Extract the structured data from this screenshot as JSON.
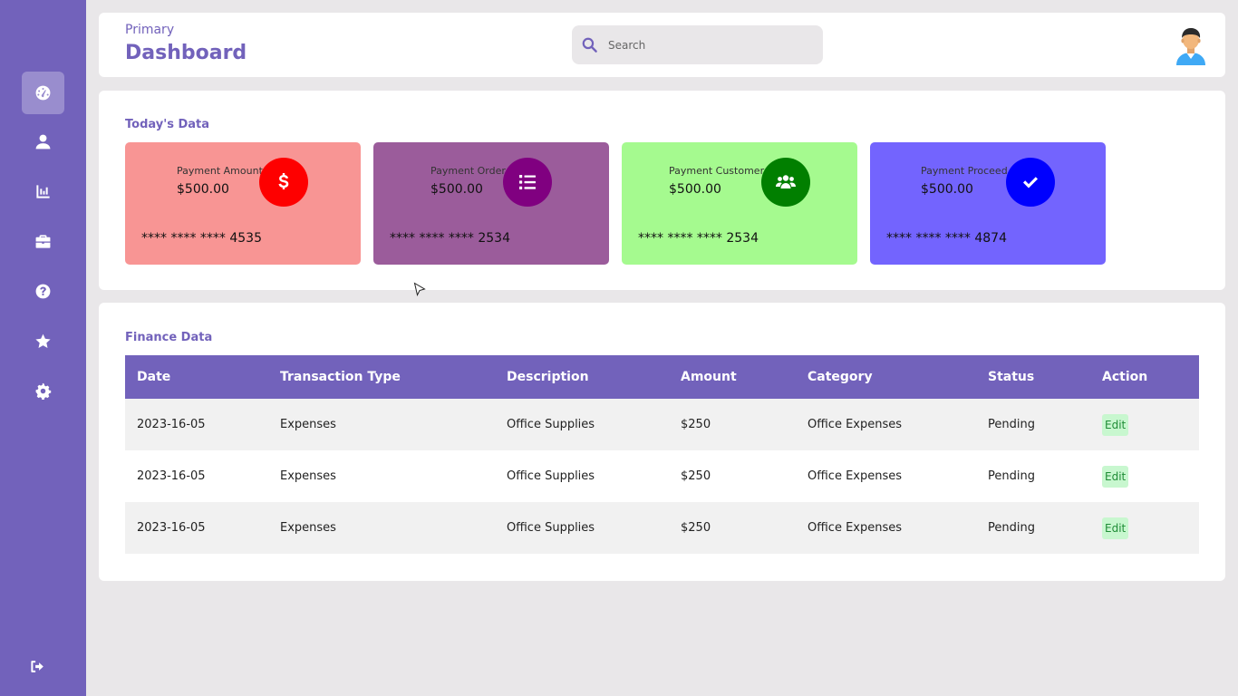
{
  "header": {
    "breadcrumb": "Primary",
    "title": "Dashboard",
    "search_placeholder": "Search"
  },
  "sidebar": {
    "items": [
      {
        "icon": "dashboard-icon",
        "active": true
      },
      {
        "icon": "user-icon"
      },
      {
        "icon": "chart-icon"
      },
      {
        "icon": "briefcase-icon"
      },
      {
        "icon": "help-icon"
      },
      {
        "icon": "star-icon"
      },
      {
        "icon": "gear-icon"
      }
    ],
    "logout_icon": "logout-icon"
  },
  "today": {
    "title": "Today's Data",
    "cards": [
      {
        "label": "Payment Amount",
        "value": "$500.00",
        "number": "**** **** **** 4535",
        "color": "#f89594",
        "circle_color": "#fe0000",
        "icon": "dollar-icon"
      },
      {
        "label": "Payment Order",
        "value": "$500.00",
        "number": "**** **** **** 2534",
        "color": "#9b5c9b",
        "circle_color": "#800080",
        "icon": "list-icon"
      },
      {
        "label": "Payment Customer",
        "value": "$500.00",
        "number": "**** **** **** 2534",
        "color": "#a5fa8f",
        "circle_color": "#017f00",
        "icon": "users-icon"
      },
      {
        "label": "Payment Proceed",
        "value": "$500.00",
        "number": "**** **** **** 4874",
        "color": "#7364fe",
        "circle_color": "#0000fe",
        "icon": "check-icon"
      }
    ]
  },
  "finance": {
    "title": "Finance Data",
    "columns": [
      "Date",
      "Transaction Type",
      "Description",
      "Amount",
      "Category",
      "Status",
      "Action"
    ],
    "rows": [
      {
        "date": "2023-16-05",
        "type": "Expenses",
        "description": "Office Supplies",
        "amount": "$250",
        "category": "Office Expenses",
        "status": "Pending",
        "action": "Edit"
      },
      {
        "date": "2023-16-05",
        "type": "Expenses",
        "description": "Office Supplies",
        "amount": "$250",
        "category": "Office Expenses",
        "status": "Pending",
        "action": "Edit"
      },
      {
        "date": "2023-16-05",
        "type": "Expenses",
        "description": "Office Supplies",
        "amount": "$250",
        "category": "Office Expenses",
        "status": "Pending",
        "action": "Edit"
      }
    ]
  }
}
